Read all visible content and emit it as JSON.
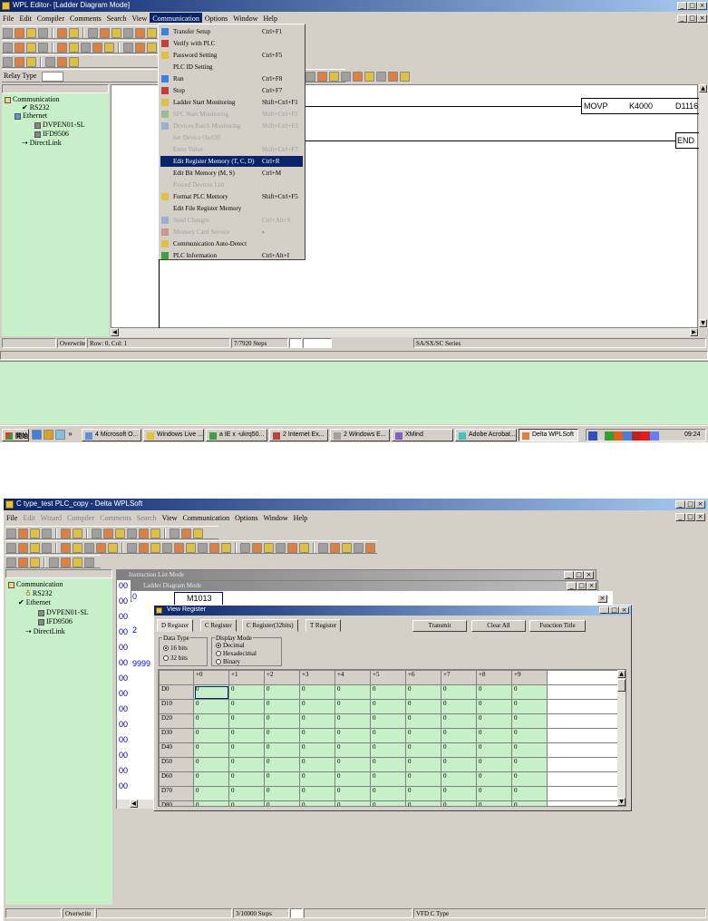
{
  "s1": {
    "title": "WPL Editor- [Ladder Diagram Mode]",
    "menu": [
      "File",
      "Edit",
      "Compiler",
      "Comments",
      "Search",
      "View",
      "Communication",
      "Options",
      "Window",
      "Help"
    ],
    "relay_type_label": "Relay Type",
    "comm_menu": [
      {
        "label": "Transfer Setup",
        "shortcut": "Ctrl+F1",
        "state": "normal",
        "icon": "transfer-icon"
      },
      {
        "label": "Verify with PLC",
        "shortcut": "",
        "state": "normal",
        "icon": "verify-icon"
      },
      {
        "label": "Password Setting",
        "shortcut": "Ctrl+F5",
        "state": "normal",
        "icon": "password-icon"
      },
      {
        "label": "PLC ID Setting",
        "shortcut": "",
        "state": "normal",
        "icon": ""
      },
      {
        "label": "Run",
        "shortcut": "Ctrl+F8",
        "state": "normal",
        "icon": "run-icon"
      },
      {
        "label": "Stop",
        "shortcut": "Ctrl+F7",
        "state": "normal",
        "icon": "stop-icon"
      },
      {
        "label": "Ladder Start Monitoring",
        "shortcut": "Shift+Ctrl+F1",
        "state": "normal",
        "icon": "monitor-icon"
      },
      {
        "label": "SFC Start Monitoring",
        "shortcut": "Shift+Ctrl+F2",
        "state": "disabled",
        "icon": "sfc-icon"
      },
      {
        "label": "Devices Batch Monitoring",
        "shortcut": "Shift+Ctrl+F3",
        "state": "disabled",
        "icon": "batch-icon"
      },
      {
        "label": "Set Device On/Off",
        "shortcut": "",
        "state": "disabled",
        "icon": ""
      },
      {
        "label": "Enter Value",
        "shortcut": "Shift+Ctrl+F7",
        "state": "disabled",
        "icon": ""
      },
      {
        "label": "Edit Register Memory (T, C, D)",
        "shortcut": "Ctrl+R",
        "state": "selected",
        "icon": ""
      },
      {
        "label": "Edit Bit Memory (M, S)",
        "shortcut": "Ctrl+M",
        "state": "normal",
        "icon": ""
      },
      {
        "label": "Forced Devices List",
        "shortcut": "",
        "state": "disabled",
        "icon": ""
      },
      {
        "label": "Format PLC Memory",
        "shortcut": "Shift+Ctrl+F5",
        "state": "normal",
        "icon": "format-icon"
      },
      {
        "label": "Edit File Register Memory",
        "shortcut": "",
        "state": "normal",
        "icon": ""
      },
      {
        "label": "Send Changes",
        "shortcut": "Ctrl+Alt+S",
        "state": "disabled",
        "icon": "send-icon"
      },
      {
        "label": "Memory Card Service",
        "shortcut": "▸",
        "state": "disabled",
        "icon": "card-icon"
      },
      {
        "label": "Communication Auto-Detect",
        "shortcut": "",
        "state": "normal",
        "icon": "detect-icon"
      },
      {
        "label": "PLC Information",
        "shortcut": "Ctrl+Alt+I",
        "state": "normal",
        "icon": "info-icon"
      }
    ],
    "tree": {
      "root": "Communication",
      "rs": "RS232",
      "eth": "Ethernet",
      "d1": "DVPEN01-SL",
      "d2": "IFD9506",
      "dl": "DirectLink"
    },
    "ladder": {
      "instr": "MOVP",
      "src": "K4000",
      "dst": "D1116",
      "end": "END"
    },
    "status": {
      "mode": "Overwrite",
      "pos": "Row: 0, Col: 1",
      "steps": "7/7920 Steps",
      "series": "SA/SX/SC Series"
    },
    "taskbar": {
      "start": "開始",
      "items": [
        "4 Microsoft O...",
        "Windows Live ...",
        "a IE x -ukrq50...",
        "2 Internet Ex...",
        "2 Windows E...",
        "XMind",
        "Adobe Acrobat...",
        "Delta WPLSoft"
      ],
      "clock": "09:24"
    }
  },
  "s2": {
    "title": "C type_test PLC_copy - Delta WPLSoft",
    "menu": [
      "File",
      "Edit",
      "Wizard",
      "Compiler",
      "Comments",
      "Search",
      "View",
      "Communication",
      "Options",
      "Window",
      "Help"
    ],
    "menu_dim": [
      false,
      true,
      true,
      true,
      true,
      true,
      false,
      false,
      false,
      false,
      false
    ],
    "tree": {
      "root": "Communication",
      "rs": "RS232",
      "eth": "Ethernet",
      "d1": "DVPEN01-SL",
      "d2": "IFD9506",
      "dl": "DirectLink"
    },
    "instr_title": "Instruction List Mode",
    "ladder_title": "Ladder Diagram Mode",
    "ladder_contact": "M1013",
    "left_codes": [
      "00",
      "00",
      "00",
      "00",
      "00",
      "00",
      "00",
      "00",
      "00",
      "00",
      "00",
      "00",
      "00",
      "00"
    ],
    "left_marks": [
      "0",
      "2",
      "9999"
    ],
    "vr": {
      "title": "View Register",
      "tabs": [
        "D Register",
        "C Register",
        "C Register(32bits)",
        "T Register"
      ],
      "transmit": "Transmit",
      "clear": "Clear All",
      "func": "Function Title",
      "dtype_label": "Data Type",
      "dtype_opts": [
        "16 bits",
        "32 bits"
      ],
      "dmode_label": "Display Mode",
      "dmode_opts": [
        "Decimal",
        "Hexadecimal",
        "Binary"
      ],
      "cols": [
        "+0",
        "+1",
        "+2",
        "+3",
        "+4",
        "+5",
        "+6",
        "+7",
        "+8",
        "+9"
      ],
      "rows": [
        "D0",
        "D10",
        "D20",
        "D30",
        "D40",
        "D50",
        "D60",
        "D70",
        "D80"
      ],
      "cell": "0"
    },
    "status": {
      "mode": "Overwrite",
      "steps": "3/10000 Steps",
      "series": "VFD C Type"
    }
  }
}
